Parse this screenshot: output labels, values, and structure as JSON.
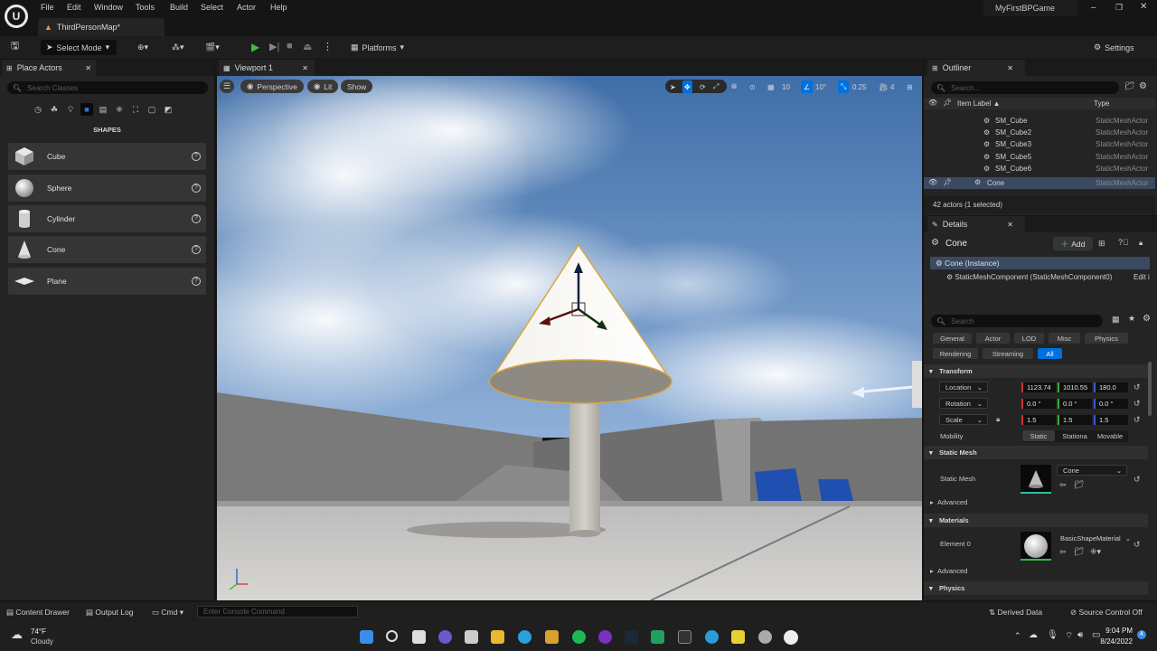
{
  "menu": {
    "items": [
      "File",
      "Edit",
      "Window",
      "Tools",
      "Build",
      "Select",
      "Actor",
      "Help"
    ],
    "project_name": "MyFirstBPGame"
  },
  "level_tab": {
    "label": "ThirdPersonMap*"
  },
  "toolbar": {
    "select_mode": "Select Mode",
    "platforms": "Platforms",
    "settings": "Settings"
  },
  "place_actors": {
    "title": "Place Actors",
    "search_placeholder": "Search Classes",
    "category": "SHAPES",
    "items": [
      {
        "label": "Cube"
      },
      {
        "label": "Sphere"
      },
      {
        "label": "Cylinder"
      },
      {
        "label": "Cone"
      },
      {
        "label": "Plane"
      }
    ]
  },
  "viewport": {
    "tab": "Viewport 1",
    "perspective": "Perspective",
    "lit": "Lit",
    "show": "Show",
    "grid_snap": "10",
    "rot_snap": "10°",
    "scale_snap": "0.25",
    "camera_speed": "4"
  },
  "outliner": {
    "title": "Outliner",
    "search_placeholder": "Search...",
    "col_label": "Item Label ▲",
    "col_type": "Type",
    "rows": [
      {
        "name": "SM_Cube",
        "type": "StaticMeshActor"
      },
      {
        "name": "SM_Cube2",
        "type": "StaticMeshActor"
      },
      {
        "name": "SM_Cube3",
        "type": "StaticMeshActor"
      },
      {
        "name": "SM_Cube5",
        "type": "StaticMeshActor"
      },
      {
        "name": "SM_Cube6",
        "type": "StaticMeshActor"
      },
      {
        "name": "Cone",
        "type": "StaticMeshActor"
      }
    ],
    "status": "42 actors (1 selected)"
  },
  "details": {
    "title": "Details",
    "actor_name": "Cone",
    "add_label": "Add",
    "instance_label": "Cone (Instance)",
    "component_label": "StaticMeshComponent (StaticMeshComponent0)",
    "edit_label": "Edit i",
    "search_placeholder": "Search",
    "filters_row1": [
      "General",
      "Actor",
      "LOD",
      "Misc",
      "Physics"
    ],
    "filters_row2": [
      "Rendering",
      "Streaming",
      "All"
    ],
    "transform": {
      "title": "Transform",
      "location_label": "Location",
      "rotation_label": "Rotation",
      "scale_label": "Scale",
      "location": [
        "1123.74",
        "1010.55",
        "180.0"
      ],
      "rotation": [
        "0.0 °",
        "0.0 °",
        "0.0 °"
      ],
      "scale": [
        "1.5",
        "1.5",
        "1.5"
      ],
      "mobility_label": "Mobility",
      "mobility_options": [
        "Static",
        "Stationa",
        "Movable"
      ]
    },
    "static_mesh": {
      "title": "Static Mesh",
      "label": "Static Mesh",
      "value": "Cone",
      "advanced": "Advanced"
    },
    "materials": {
      "title": "Materials",
      "element_label": "Element 0",
      "value": "BasicShapeMaterial",
      "advanced": "Advanced"
    },
    "physics": {
      "title": "Physics"
    }
  },
  "bottom": {
    "content_drawer": "Content Drawer",
    "output_log": "Output Log",
    "cmd": "Cmd",
    "console_placeholder": "Enter Console Command",
    "derived_data": "Derived Data",
    "source_control": "Source Control Off"
  },
  "taskbar": {
    "temp": "74°F",
    "weather": "Cloudy",
    "time": "9:04 PM",
    "date": "8/24/2022"
  },
  "colors": {
    "accent_blue": "#0070e0",
    "selection": "#3a4a60",
    "play_green": "#3cbf3c"
  }
}
